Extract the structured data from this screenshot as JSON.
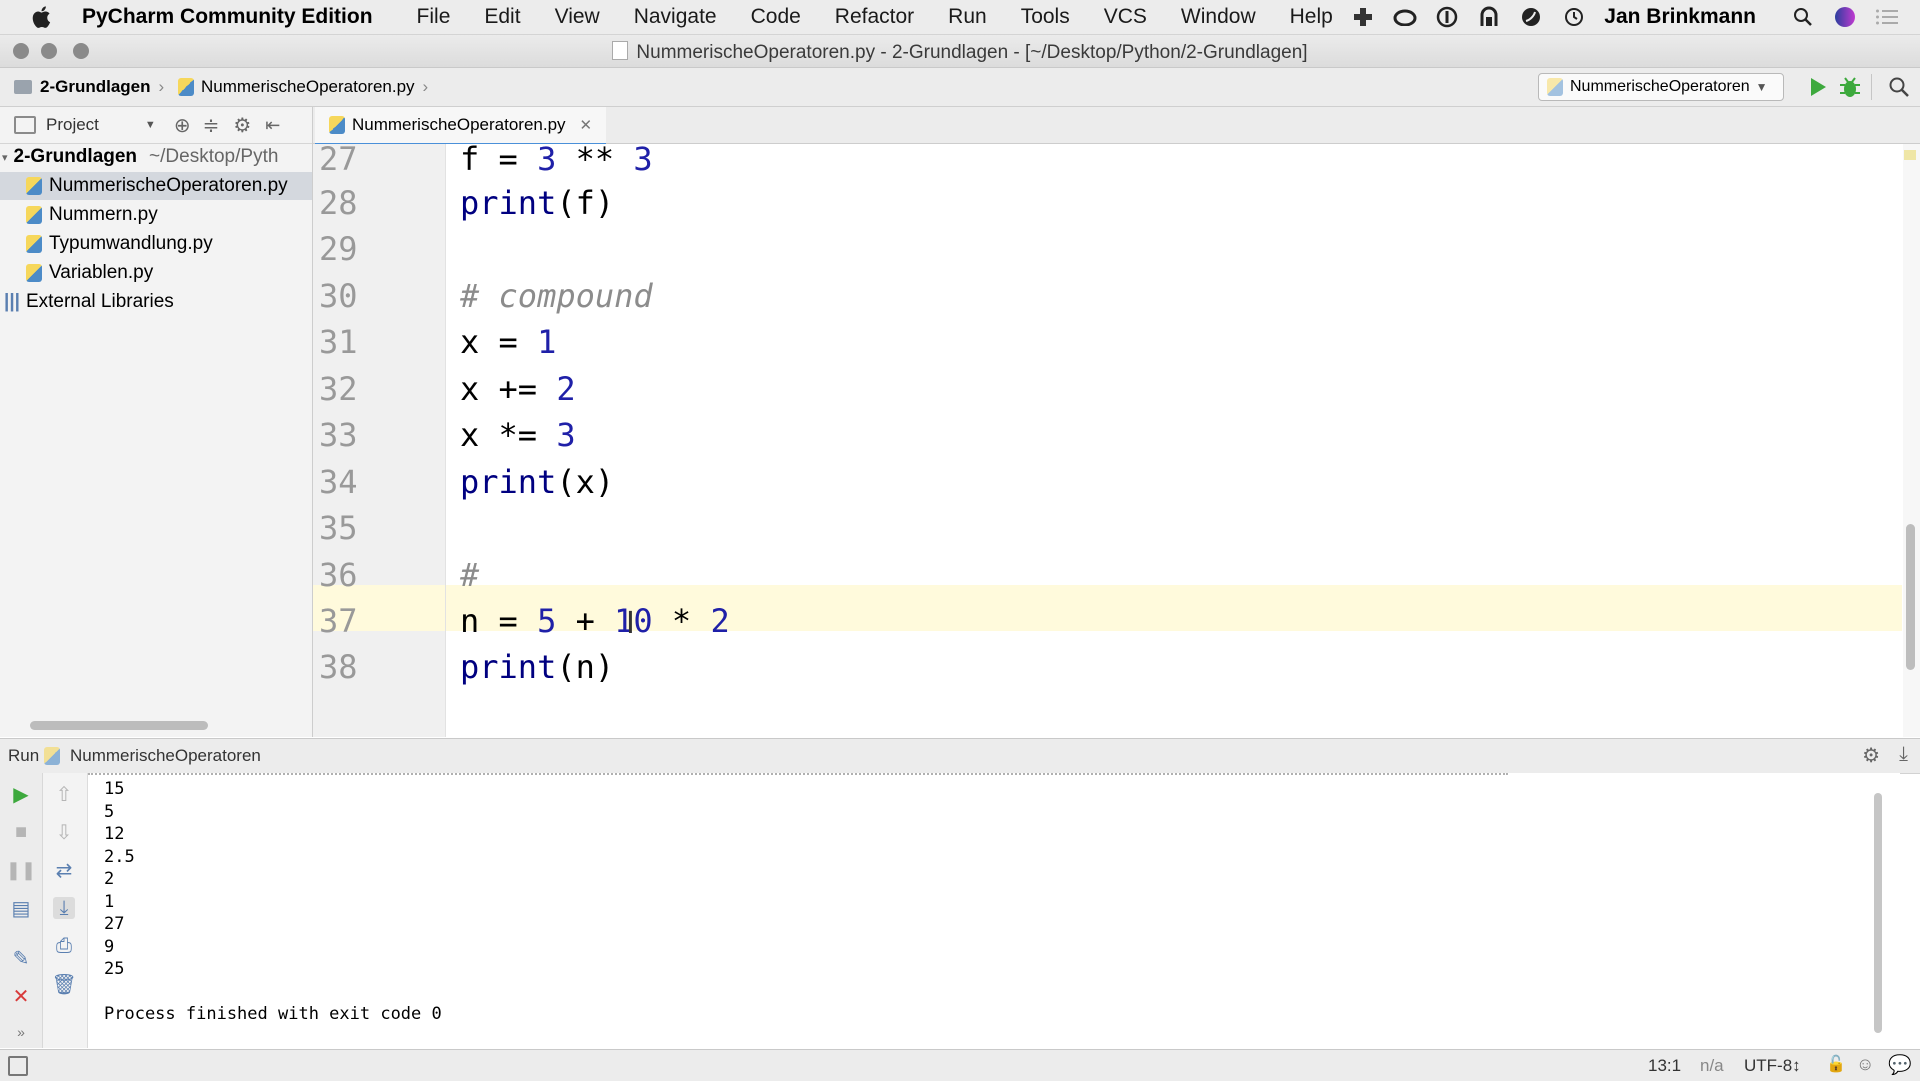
{
  "menubar": {
    "app_name": "PyCharm Community Edition",
    "items": [
      "File",
      "Edit",
      "View",
      "Navigate",
      "Code",
      "Refactor",
      "Run",
      "Tools",
      "VCS",
      "Window",
      "Help"
    ],
    "user": "Jan Brinkmann"
  },
  "window": {
    "title": "NummerischeOperatoren.py - 2-Grundlagen - [~/Desktop/Python/2-Grundlagen]"
  },
  "navbar": {
    "crumb_folder": "2-Grundlagen",
    "crumb_file": "NummerischeOperatoren.py",
    "run_config": "NummerischeOperatoren"
  },
  "sidebar": {
    "view_label": "Project",
    "root_name": "2-Grundlagen",
    "root_path": "~/Desktop/Pyth",
    "files": [
      "NummerischeOperatoren.py",
      "Nummern.py",
      "Typumwandlung.py",
      "Variablen.py"
    ],
    "external": "External Libraries"
  },
  "editor": {
    "tab_label": "NummerischeOperatoren.py",
    "line_numbers": [
      "27",
      "28",
      "29",
      "30",
      "31",
      "32",
      "33",
      "34",
      "35",
      "36",
      "37",
      "38"
    ],
    "current_line": "37"
  },
  "run": {
    "label": "Run",
    "config": "NummerischeOperatoren",
    "output": [
      "15",
      "5",
      "12",
      "2.5",
      "2",
      "1",
      "27",
      "9",
      "25"
    ],
    "finished": "Process finished with exit code 0"
  },
  "status": {
    "position": "13:1",
    "na": "n/a",
    "encoding": "UTF-8↕"
  },
  "colors": {
    "number": "#1f20a8",
    "comment": "#8c8c8c",
    "current_line_bg": "#fffadc",
    "run_green": "#3da93d",
    "stop_red": "#d83a3a"
  }
}
